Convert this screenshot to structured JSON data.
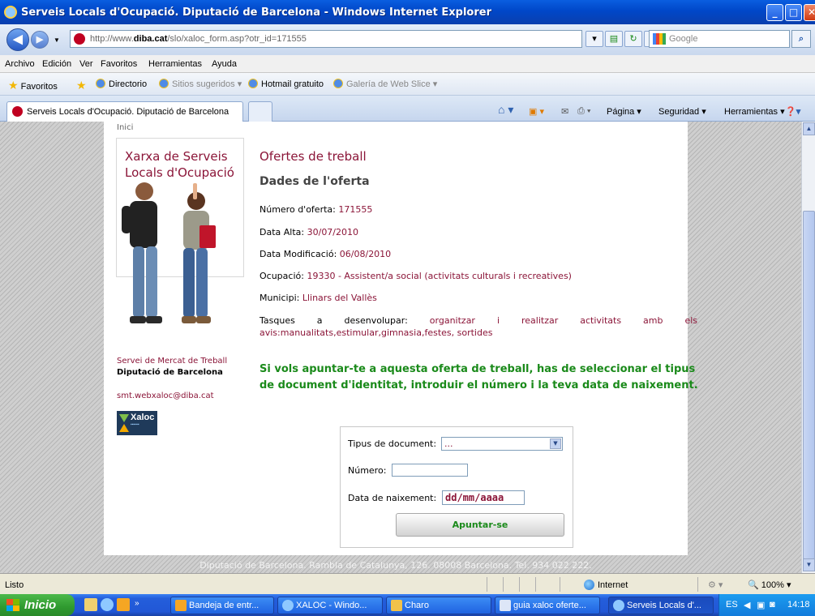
{
  "window": {
    "title": "Serveis Locals d'Ocupació. Diputació de Barcelona - Windows Internet Explorer"
  },
  "address": {
    "url_prefix": "http://www.",
    "url_domain": "diba.cat",
    "url_path": "/slo/xaloc_form.asp?otr_id=171555",
    "search_placeholder": "Google"
  },
  "menu": {
    "items": [
      "Archivo",
      "Edición",
      "Ver",
      "Favoritos",
      "Herramientas",
      "Ayuda"
    ]
  },
  "favorites": {
    "label": "Favoritos",
    "items": [
      "Directorio",
      "Sitios sugeridos ▾",
      "Hotmail gratuito",
      "Galería de Web Slice ▾"
    ]
  },
  "tab": {
    "active_label": "Serveis Locals d'Ocupació. Diputació de Barcelona"
  },
  "commandbar": {
    "pagina": "Página ▾",
    "seguridad": "Seguridad ▾",
    "herramientas": "Herramientas ▾"
  },
  "page": {
    "breadcrumb": "Inici",
    "brand_title": "Xarxa de Serveis Locals d'Ocupació",
    "service": "Servei de Mercat de Treball",
    "organization": "Diputació de Barcelona",
    "email": "smt.webxaloc@diba.cat",
    "logo_text": "Xaloc",
    "heading": "Ofertes de treball",
    "subheading": "Dades de l'oferta",
    "fields": {
      "numero_label": "Número d'oferta:",
      "numero_value": "171555",
      "alta_label": "Data Alta:",
      "alta_value": "30/07/2010",
      "modif_label": "Data Modificació:",
      "modif_value": "06/08/2010",
      "ocupacio_label": "Ocupació:",
      "ocupacio_value": "19330 - Assistent/a social (activitats culturals i recreatives)",
      "municipi_label": "Municipi:",
      "municipi_value": "Llinars del Vallès",
      "tasques_label": "Tasques a desenvolupar:",
      "tasques_value": "organitzar i realitzar activitats amb els avis:manualitats,estimular,gimnasia,festes, sortides"
    },
    "cta": "Si vols apuntar-te a aquesta oferta de treball, has de seleccionar el tipus de document d'identitat, introduir el número i la teva data de naixement.",
    "form": {
      "doc_label": "Tipus de document:",
      "doc_value": "...",
      "num_label": "Número:",
      "num_value": "",
      "date_label": "Data de naixement:",
      "date_value": "dd/mm/aaaa",
      "submit": "Apuntar-se"
    },
    "footer": "Diputació de Barcelona. Rambla de Catalunya, 126. 08008 Barcelona. Tel. 934 022 222."
  },
  "statusbar": {
    "status": "Listo",
    "zone": "Internet",
    "zoom": "100%"
  },
  "taskbar": {
    "start": "Inicio",
    "items": [
      "Bandeja de entr...",
      "XALOC - Windo...",
      "Charo",
      "guia xaloc oferte...",
      "Serveis Locals d'..."
    ],
    "lang": "ES",
    "clock": "14:18"
  },
  "colors": {
    "accent": "#8b1538",
    "cta_green": "#1a8a1a",
    "titlebar_blue": "#0047c8"
  }
}
